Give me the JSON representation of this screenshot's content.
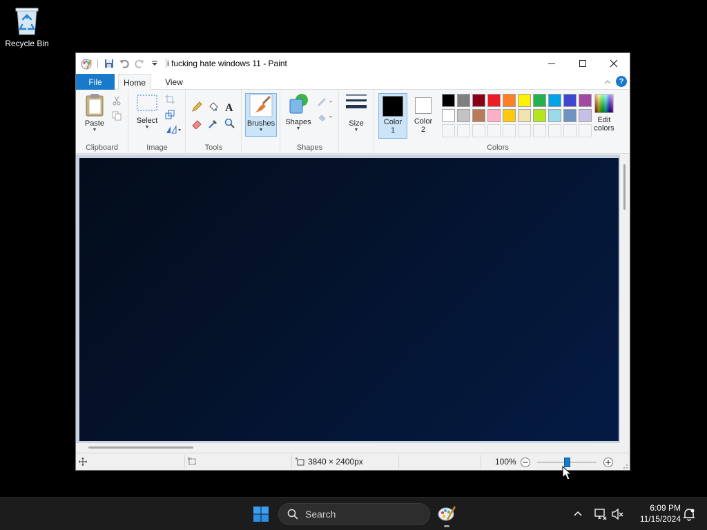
{
  "desktop": {
    "recycle_bin_label": "Recycle Bin"
  },
  "window": {
    "title": "i fucking hate windows 11 - Paint"
  },
  "tabs": {
    "file": "File",
    "home": "Home",
    "view": "View",
    "help": "?"
  },
  "ribbon": {
    "clipboard": {
      "paste": "Paste",
      "label": "Clipboard"
    },
    "image": {
      "select": "Select",
      "label": "Image"
    },
    "tools": {
      "label": "Tools"
    },
    "brushes": {
      "label": "Brushes"
    },
    "shapes": {
      "shapes_btn": "Shapes",
      "label": "Shapes"
    },
    "size": {
      "label": "Size"
    },
    "colors": {
      "color1_line1": "Color",
      "color1_line2": "1",
      "color2_line1": "Color",
      "color2_line2": "2",
      "edit_line1": "Edit",
      "edit_line2": "colors",
      "label": "Colors",
      "color1_value": "#000000",
      "color2_value": "#ffffff",
      "palette_row1": [
        "#000000",
        "#7f7f7f",
        "#880015",
        "#ed1c24",
        "#ff7f27",
        "#fff200",
        "#22b14c",
        "#00a2e8",
        "#3f48cc",
        "#a349a4"
      ],
      "palette_row2": [
        "#ffffff",
        "#c3c3c3",
        "#b97a57",
        "#ffaec9",
        "#ffc90e",
        "#efe4b0",
        "#b5e61d",
        "#99d9ea",
        "#7092be",
        "#c8bfe7"
      ]
    }
  },
  "canvas": {
    "color_top_left": "#030c1a",
    "color_bottom_right": "#051b44"
  },
  "statusbar": {
    "dimensions": "3840 × 2400px",
    "zoom": "100%",
    "zoom_fraction": 0.5
  },
  "taskbar": {
    "search_placeholder": "Search",
    "time": "6:09 PM",
    "date": "11/15/2024"
  }
}
